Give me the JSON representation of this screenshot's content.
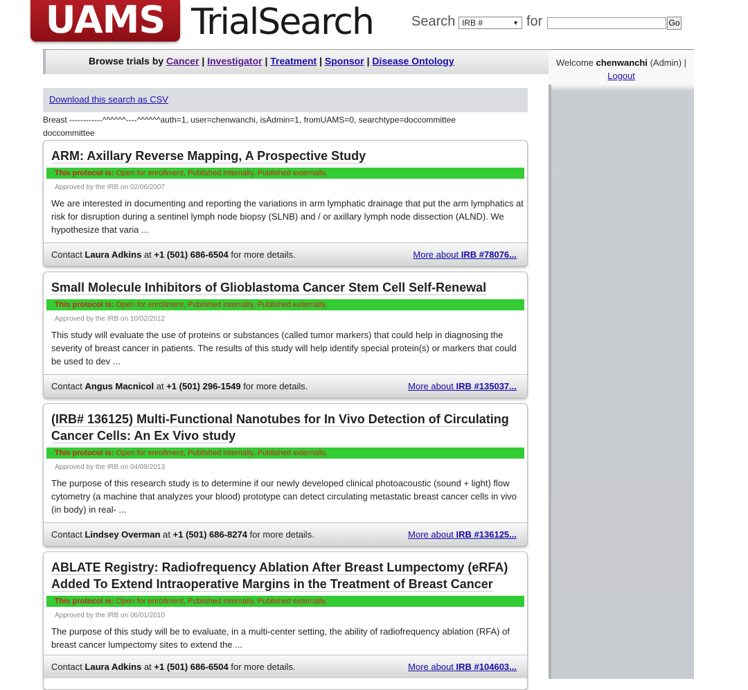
{
  "header": {
    "logo_text": "UAMS",
    "site_title": "TrialSearch",
    "search_label": "Search",
    "search_select_value": "IRB #",
    "for_label": "for",
    "search_input_value": "",
    "go_label": "Go"
  },
  "browse": {
    "prefix": "Browse trials by",
    "links": [
      "Cancer",
      "Investigator",
      "Treatment",
      "Sponsor",
      "Disease Ontology"
    ],
    "separator": "|"
  },
  "user": {
    "welcome_label": "Welcome",
    "username": "chenwanchi",
    "role": "(Admin) |",
    "logout_label": "Logout"
  },
  "csv_link": "Download this search as CSV",
  "debug_line1": "Breast ------------^^^^^^----^^^^^^auth=1, user=chenwanchi, isAdmin=1, fromUAMS=0, searchtype=doccommittee",
  "debug_line2": "doccommittee",
  "colors": {
    "status_green": "#33cc33",
    "status_text": "#cc2222",
    "logo_red": "#a8151d"
  },
  "trials": [
    {
      "title": "ARM: Axillary Reverse Mapping, A Prospective Study",
      "status_label": "This protocol is:",
      "status_value": "Open for enrollment, Published internally, Published externally,",
      "approved": "Approved by the IRB on 02/06/2007",
      "summary": "We are interested in documenting and reporting the variations in arm lymphatic drainage that put the arm lymphatics at risk for disruption during a sentinel lymph node biopsy (SLNB) and / or axillary lymph node dissection (ALND). We hypothesize that varia ...",
      "contact_prefix": "Contact",
      "contact_name": "Laura Adkins",
      "contact_at": "at",
      "contact_phone": "+1 (501) 686-6504",
      "contact_suffix": "for more details.",
      "more_prefix": "More about",
      "more_irb": "IRB #78076..."
    },
    {
      "title": "Small Molecule Inhibitors of Glioblastoma Cancer Stem Cell Self-Renewal",
      "status_label": "This protocol is:",
      "status_value": "Open for enrollment, Published internally, Published externally,",
      "approved": "Approved by the IRB on 10/02/2012",
      "summary": "This study will evaluate the use of proteins or substances (called tumor markers) that could help in diagnosing the severity of breast cancer in patients. The results of this study will help identify special protein(s) or markers that could be used to dev ...",
      "contact_prefix": "Contact",
      "contact_name": "Angus Macnicol",
      "contact_at": "at",
      "contact_phone": "+1 (501) 296-1549",
      "contact_suffix": "for more details.",
      "more_prefix": "More about",
      "more_irb": "IRB #135037..."
    },
    {
      "title": "(IRB# 136125) Multi-Functional Nanotubes for In Vivo Detection of Circulating Cancer Cells: An Ex Vivo study",
      "status_label": "This protocol is:",
      "status_value": "Open for enrollment, Published internally, Published externally,",
      "approved": "Approved by the IRB on 04/09/2013",
      "summary": "The purpose of this research study is to determine if our newly developed clinical photoacoustic (sound + light) flow cytometry (a machine that analyzes your blood) prototype can detect circulating metastatic breast cancer cells in vivo (in body) in real- ...",
      "contact_prefix": "Contact",
      "contact_name": "Lindsey Overman",
      "contact_at": "at",
      "contact_phone": "+1 (501) 686-8274",
      "contact_suffix": "for more details.",
      "more_prefix": "More about",
      "more_irb": "IRB #136125..."
    },
    {
      "title": "ABLATE Registry: Radiofrequency Ablation After Breast Lumpectomy (eRFA) Added To Extend Intraoperative Margins in the Treatment of Breast Cancer",
      "status_label": "This protocol is:",
      "status_value": "Open for enrollment, Published internally, Published externally,",
      "approved": "Approved by the IRB on 06/01/2010",
      "summary": "The purpose of this study will be to evaluate, in a multi-center setting, the ability of radiofrequency ablation (RFA) of breast cancer lumpectomy sites to extend the ...",
      "contact_prefix": "Contact",
      "contact_name": "Laura Adkins",
      "contact_at": "at",
      "contact_phone": "+1 (501) 686-6504",
      "contact_suffix": "for more details.",
      "more_prefix": "More about",
      "more_irb": "IRB #104603..."
    }
  ]
}
